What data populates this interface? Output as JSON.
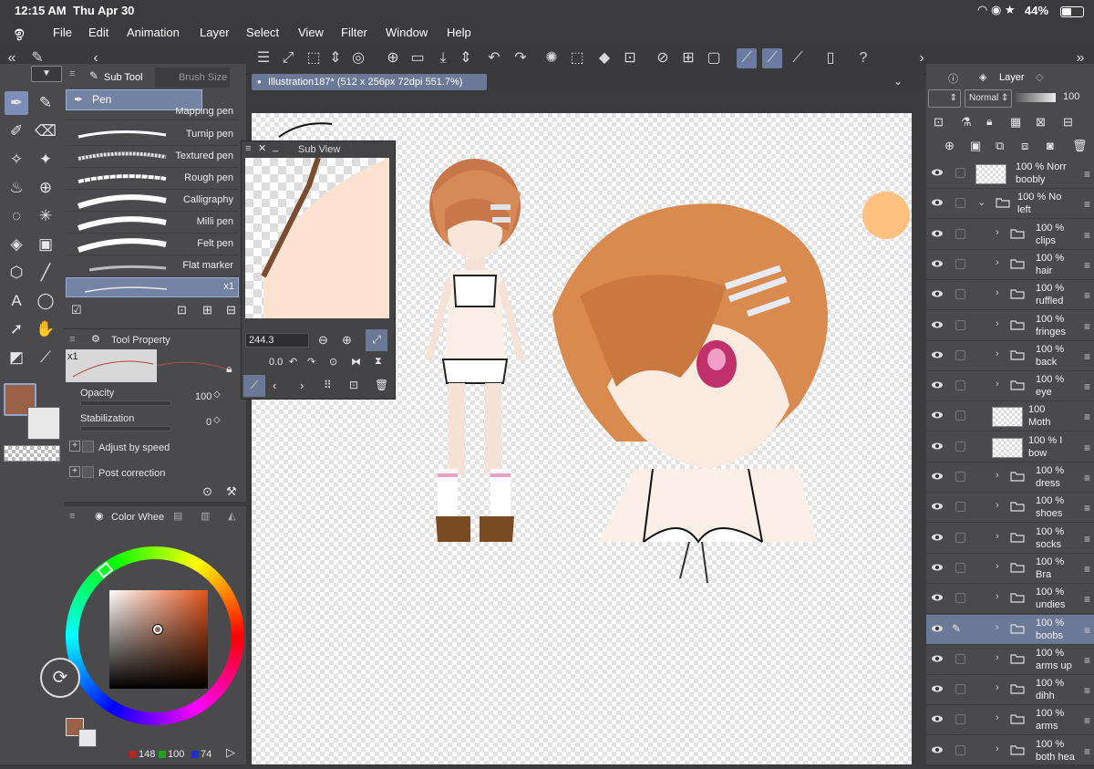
{
  "status": {
    "time": "12:15 AM",
    "date": "Thu Apr 30",
    "battery": "44%"
  },
  "menu": [
    "File",
    "Edit",
    "Animation",
    "Layer",
    "Select",
    "View",
    "Filter",
    "Window",
    "Help"
  ],
  "canvas_tab": "Illustration187* (512 x 256px 72dpi 551.7%)",
  "subtool": {
    "tab_active": "Sub Tool",
    "tab_inactive": "Brush Size",
    "selected_group": "Pen",
    "brushes": [
      "Mapping pen",
      "Turnip pen",
      "Textured pen",
      "Rough pen",
      "Calligraphy",
      "Milli pen",
      "Felt pen",
      "Flat marker"
    ],
    "selected_marker": "x1"
  },
  "tool_property": {
    "title": "Tool Property",
    "curve_label": "x1",
    "opacity_label": "Opacity",
    "opacity_value": "100",
    "stabilization_label": "Stabilization",
    "stabilization_value": "0",
    "adjust_speed_label": "Adjust by speed",
    "post_correction_label": "Post correction"
  },
  "subview": {
    "title": "Sub View",
    "zoom_value": "244.3",
    "rotation_value": "0.0"
  },
  "color": {
    "panel_title": "Color Whee",
    "main_hex": "#9a6048",
    "sub_hex": "#e8e8e8",
    "r": "148",
    "g": "100",
    "b": "74",
    "square_hue_hex": "#e0531a"
  },
  "layer_panel": {
    "title": "Layer",
    "blend_mode": "Normal",
    "opacity": "100",
    "layers": [
      {
        "pct": "100 %",
        "mode": "Norr",
        "name": "boobly",
        "type": "raster",
        "indent": 0
      },
      {
        "pct": "100 %",
        "mode": "No",
        "name": "left",
        "type": "folder",
        "indent": 0,
        "expanded": true
      },
      {
        "pct": "100 %",
        "name": "clips",
        "type": "folder",
        "indent": 1
      },
      {
        "pct": "100 %",
        "name": "hair",
        "type": "folder",
        "indent": 1
      },
      {
        "pct": "100 %",
        "name": "ruffled",
        "type": "folder",
        "indent": 1
      },
      {
        "pct": "100 %",
        "name": "fringes",
        "type": "folder",
        "indent": 1
      },
      {
        "pct": "100 %",
        "name": "back",
        "type": "folder",
        "indent": 1
      },
      {
        "pct": "100 %",
        "name": "eye",
        "type": "folder",
        "indent": 1
      },
      {
        "pct": "100",
        "name": "Moth",
        "type": "raster",
        "indent": 1
      },
      {
        "pct": "100 % I",
        "name": "bow",
        "type": "raster",
        "indent": 1
      },
      {
        "pct": "100 %",
        "name": "dress",
        "type": "folder",
        "indent": 1
      },
      {
        "pct": "100 %",
        "name": "shoes",
        "type": "folder",
        "indent": 1
      },
      {
        "pct": "100 %",
        "name": "socks",
        "type": "folder",
        "indent": 1
      },
      {
        "pct": "100 %",
        "name": "Bra",
        "type": "folder",
        "indent": 1
      },
      {
        "pct": "100 %",
        "name": "undies",
        "type": "folder",
        "indent": 1
      },
      {
        "pct": "100 %",
        "name": "boobs",
        "type": "folder",
        "indent": 1,
        "selected": true
      },
      {
        "pct": "100 %",
        "name": "arms up",
        "type": "folder",
        "indent": 1
      },
      {
        "pct": "100 %",
        "name": "dihh",
        "type": "folder",
        "indent": 1
      },
      {
        "pct": "100 %",
        "name": "arms",
        "type": "folder",
        "indent": 1
      },
      {
        "pct": "100 %",
        "name": "both hea",
        "type": "folder",
        "indent": 1
      }
    ]
  }
}
